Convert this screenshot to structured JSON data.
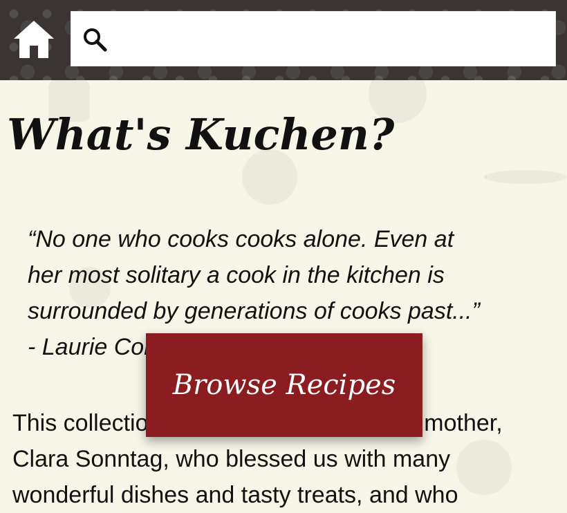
{
  "header": {
    "home_icon": "home-icon",
    "search_icon": "search-icon",
    "search": {
      "value": "",
      "placeholder": ""
    }
  },
  "content": {
    "title": "What's Kuchen?",
    "quote_lines": [
      "“No one who cooks cooks alone. Even at",
      "her most solitary a cook in the kitchen is",
      "surrounded by generations of cooks past...”",
      "- Laurie Colwin"
    ],
    "intro_lines": [
      "This collection is dedicated to my grandmother,",
      "Clara Sonntag, who blessed us with many",
      "wonderful dishes and tasty treats, and who"
    ]
  },
  "browse_button": {
    "label": "Browse Recipes"
  },
  "colors": {
    "header_bg": "#3a3532",
    "page_bg": "#f7f5e7",
    "button_bg": "#8b1c1f",
    "button_text": "#ffffff"
  }
}
